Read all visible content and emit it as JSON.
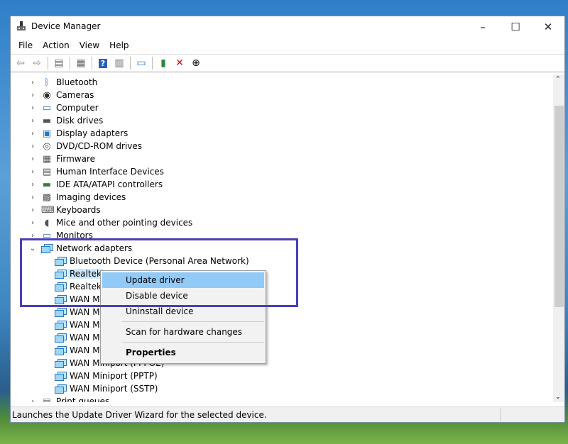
{
  "window": {
    "title": "Device Manager",
    "minimize": "–",
    "maximize": "☐",
    "close": "✕"
  },
  "menu": [
    "File",
    "Action",
    "View",
    "Help"
  ],
  "toolbar": [
    "back-icon",
    "forward-icon",
    "properties-view-icon",
    "console-tree-icon",
    "help-icon",
    "action-pane-icon",
    "monitor-icon",
    "enable-device-icon",
    "uninstall-icon",
    "update-driver-icon"
  ],
  "tree": {
    "categories": [
      {
        "label": "Bluetooth",
        "icon": "bluetooth-icon"
      },
      {
        "label": "Cameras",
        "icon": "camera-icon"
      },
      {
        "label": "Computer",
        "icon": "computer-icon"
      },
      {
        "label": "Disk drives",
        "icon": "disk-icon"
      },
      {
        "label": "Display adapters",
        "icon": "display-icon"
      },
      {
        "label": "DVD/CD-ROM drives",
        "icon": "dvd-icon"
      },
      {
        "label": "Firmware",
        "icon": "chip-icon"
      },
      {
        "label": "Human Interface Devices",
        "icon": "hid-icon"
      },
      {
        "label": "IDE ATA/ATAPI controllers",
        "icon": "ide-icon"
      },
      {
        "label": "Imaging devices",
        "icon": "imaging-icon"
      },
      {
        "label": "Keyboards",
        "icon": "keyboard-icon"
      },
      {
        "label": "Mice and other pointing devices",
        "icon": "mouse-icon"
      },
      {
        "label": "Monitors",
        "icon": "monitor-icon"
      }
    ],
    "expanded": {
      "label": "Network adapters",
      "children": [
        "Bluetooth Device (Personal Area Network)",
        "Realtek",
        "Realtek",
        "WAN M",
        "WAN M",
        "WAN M",
        "WAN M",
        "WAN M",
        "WAN Miniport (PPPOE)",
        "WAN Miniport (PPTP)",
        "WAN Miniport (SSTP)"
      ]
    },
    "after": "Print queues"
  },
  "context_menu": {
    "items": [
      "Update driver",
      "Disable device",
      "Uninstall device",
      "Scan for hardware changes",
      "Properties"
    ],
    "highlighted": "Update driver"
  },
  "status": "Launches the Update Driver Wizard for the selected device.",
  "colors": {
    "highlight": "#91c9f7",
    "annotation": "#4a40b4"
  }
}
